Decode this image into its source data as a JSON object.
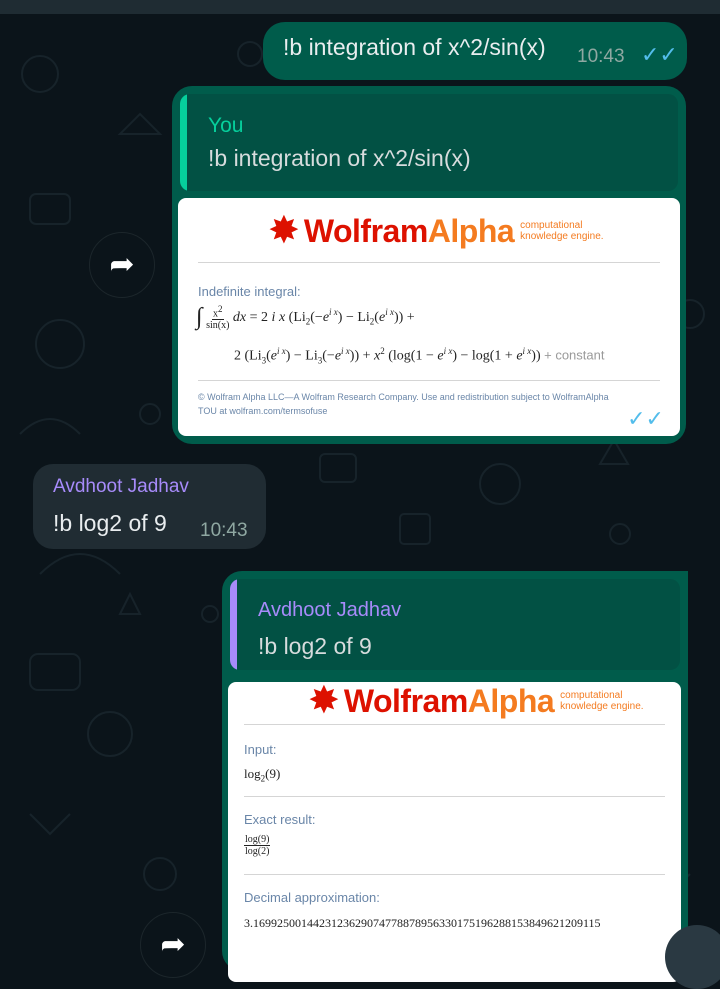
{
  "messages": {
    "m1": {
      "text": "!b integration of x^2/sin(x)",
      "time": "10:43",
      "ticks": "✓✓"
    },
    "m2": {
      "quote_author": "You",
      "quote_text": "!b integration of x^2/sin(x)",
      "card": {
        "brand_main": "Wolfram",
        "brand_alpha": "Alpha",
        "brand_tag_1": "computational",
        "brand_tag_2": "knowledge engine.",
        "pod_title": "Indefinite integral:",
        "constant": "+ constant",
        "copyright_1": "© Wolfram Alpha LLC—A Wolfram Research Company. Use and redistribution subject to WolframAlpha",
        "copyright_2": "TOU at wolfram.com/termsofuse"
      },
      "time": "10:43",
      "ticks": "✓✓"
    },
    "m3": {
      "author": "Avdhoot Jadhav",
      "text": "!b log2 of 9",
      "time": "10:43"
    },
    "m4": {
      "quote_author": "Avdhoot Jadhav",
      "quote_text": "!b log2 of 9",
      "card": {
        "brand_main": "Wolfram",
        "brand_alpha": "Alpha",
        "brand_tag_1": "computational",
        "brand_tag_2": "knowledge engine.",
        "input_title": "Input:",
        "input_value_fn": "log",
        "input_value_sub": "2",
        "input_value_arg": "(9)",
        "exact_title": "Exact result:",
        "exact_num": "log(9)",
        "exact_den": "log(2)",
        "decimal_title": "Decimal approximation:",
        "decimal_value": "3.1699250014423123629074778878956330175196288153849621209115"
      }
    }
  },
  "icons": {
    "forward": "forward-arrow-icon",
    "wolfram": "wolfram-star-icon"
  },
  "colors": {
    "background": "#0b141a",
    "outgoing_bubble": "#005c4b",
    "incoming_bubble": "#202c33",
    "quote_you": "#06cf9c",
    "quote_contact": "#a78bfa",
    "read_ticks": "#53bdeb",
    "wolfram_red": "#dd1100",
    "wolfram_orange": "#f47b20"
  }
}
